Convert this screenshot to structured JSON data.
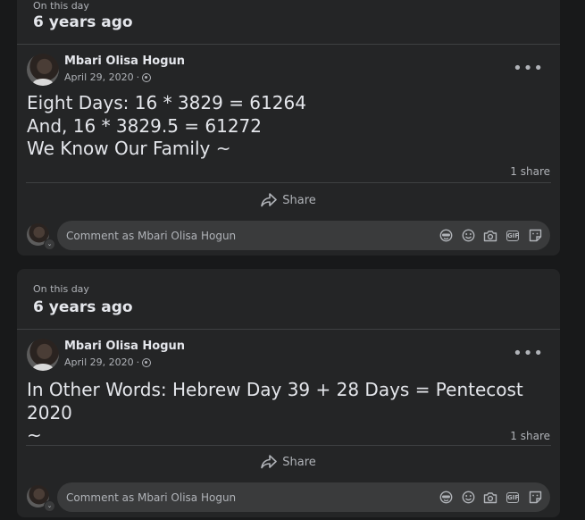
{
  "memories": [
    {
      "on_this_day": "On this day",
      "years_ago": "6 years ago",
      "author": "Mbari Olisa Hogun",
      "date": "April 29, 2020",
      "separator": "·",
      "lines": [
        "Eight Days: 16 * 3829 = 61264",
        "And, 16 * 3829.5 = 61272",
        "We Know Our Family ~"
      ],
      "shares": "1 share",
      "share_label": "Share",
      "comment_placeholder": "Comment as Mbari Olisa Hogun"
    },
    {
      "on_this_day": "On this day",
      "years_ago": "6 years ago",
      "author": "Mbari Olisa Hogun",
      "date": "April 29, 2020",
      "separator": "·",
      "lines": [
        "In Other Words: Hebrew Day 39 + 28 Days = Pentecost 2020",
        "~"
      ],
      "shares": "1 share",
      "share_label": "Share",
      "comment_placeholder": "Comment as Mbari Olisa Hogun"
    }
  ],
  "icons": {
    "more": "more-options-icon",
    "privacy": "globe-icon",
    "share": "share-arrow-icon",
    "comment_tools": [
      "avatar-sticker-icon",
      "emoji-icon",
      "camera-icon",
      "gif-icon",
      "sticker-icon"
    ]
  },
  "more_glyph": "•••",
  "gif_text": "GIF",
  "badge_glyph": "⌄",
  "colors": {
    "page_bg": "#18191a",
    "card_bg": "#242526",
    "text_primary": "#e4e6eb",
    "text_secondary": "#b0b3b8",
    "input_bg": "#3a3b3c"
  }
}
